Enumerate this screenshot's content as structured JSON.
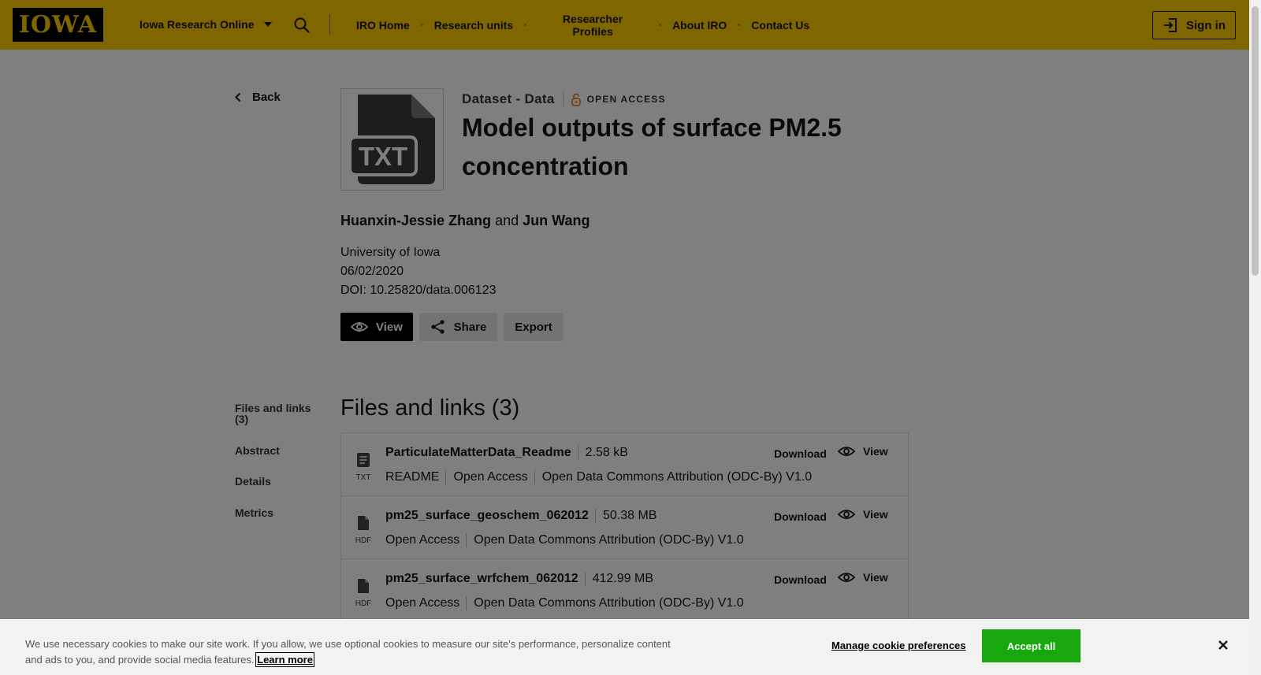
{
  "header": {
    "logo": "IOWA",
    "site_menu": "Iowa Research Online",
    "nav": [
      {
        "label": "IRO Home"
      },
      {
        "label": "Research units"
      },
      {
        "label": "Researcher\nProfiles"
      },
      {
        "label": "About IRO"
      },
      {
        "label": "Contact Us"
      }
    ],
    "signin": "Sign in"
  },
  "sidebar": {
    "back": "Back",
    "links": [
      "Files and links (3)",
      "Abstract",
      "Details",
      "Metrics"
    ]
  },
  "record": {
    "thumb_label": "TXT",
    "type": "Dataset - Data",
    "access": "OPEN ACCESS",
    "title": "Model outputs of surface PM2.5 concentration",
    "authors": [
      "Huanxin-Jessie Zhang",
      "Jun Wang"
    ],
    "authors_join": "and",
    "institution": "University of Iowa",
    "date": "06/02/2020",
    "doi": "DOI: 10.25820/data.006123"
  },
  "actions": {
    "view": "View",
    "share": "Share",
    "export": "Export"
  },
  "files": {
    "heading": "Files and links (3)",
    "download_label": "Download",
    "view_label": "View",
    "items": [
      {
        "name": "ParticulateMatterData_Readme",
        "size": "2.58 kB",
        "ext": "TXT",
        "meta": [
          "README",
          "Open Access",
          "Open Data Commons Attribution (ODC-By) V1.0"
        ]
      },
      {
        "name": "pm25_surface_geoschem_062012",
        "size": "50.38 MB",
        "ext": "HDF",
        "meta": [
          "Open Access",
          "Open Data Commons Attribution (ODC-By) V1.0"
        ]
      },
      {
        "name": "pm25_surface_wrfchem_062012",
        "size": "412.99 MB",
        "ext": "HDF",
        "meta": [
          "Open Access",
          "Open Data Commons Attribution (ODC-By) V1.0"
        ]
      }
    ]
  },
  "cookie": {
    "text": "We use necessary cookies to make our site work. If you allow, we use optional cookies to measure our site's performance, personalize content and ads to you, and provide social media features.",
    "learn_more": "Learn more",
    "manage": "Manage cookie preferences",
    "accept": "Accept all"
  },
  "colors": {
    "brand_gold": "#ffcd00",
    "brand_black": "#000000",
    "accept_green": "#16a80c",
    "open_access_orange": "#e8821e"
  }
}
